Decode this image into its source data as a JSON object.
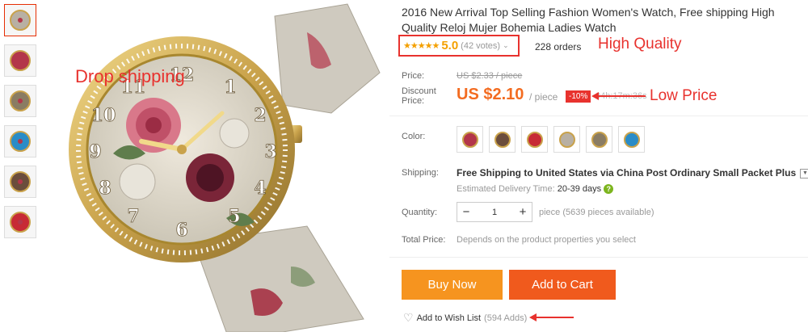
{
  "thumbnails": [
    {
      "name": "thumb-1",
      "band": "#b8b0a3"
    },
    {
      "name": "thumb-2",
      "band": "#b3364a"
    },
    {
      "name": "thumb-3",
      "band": "#8a7c63"
    },
    {
      "name": "thumb-4",
      "band": "#2a8cc7"
    },
    {
      "name": "thumb-5",
      "band": "#6b4d3c"
    },
    {
      "name": "thumb-6",
      "band": "#c72a35"
    }
  ],
  "overlays": {
    "drop_shipping": "Drop shipping",
    "high_quality": "High Quality",
    "low_price": "Low Price"
  },
  "product": {
    "title": "2016 New Arrival Top Selling Fashion Women's Watch, Free shipping High Quality Reloj Mujer Bohemia Ladies Watch",
    "stars": "★★★★★",
    "rating": "5.0",
    "votes": "(42 votes)",
    "orders": "228 orders"
  },
  "price": {
    "price_label": "Price:",
    "original": "US $2.33 / piece",
    "discount_label_1": "Discount",
    "discount_label_2": "Price:",
    "current": "US $2.10",
    "unit": "/ piece",
    "discount_badge": "-10%",
    "timer": "04h:17m:36s"
  },
  "color": {
    "label": "Color:",
    "swatches": [
      "#b3364a",
      "#6b4d3c",
      "#c72a35",
      "#b8b0a3",
      "#8a7c63",
      "#2a8cc7"
    ]
  },
  "shipping": {
    "label": "Shipping:",
    "free_text": "Free Shipping",
    "to_text": " to United States via China Post Ordinary Small Packet Plus",
    "delivery_label": "Estimated Delivery Time:",
    "delivery_value": "20-39 days"
  },
  "quantity": {
    "label": "Quantity:",
    "value": "1",
    "minus": "−",
    "plus": "+",
    "available": "piece (5639 pieces available)"
  },
  "total": {
    "label": "Total Price:",
    "value": "Depends on the product properties you select"
  },
  "actions": {
    "buy_now": "Buy Now",
    "add_to_cart": "Add to Cart",
    "wish_list": "Add to Wish List",
    "wish_count": "(594 Adds)"
  },
  "colors": {
    "accent_red": "#e8322e",
    "price_orange": "#f36c21",
    "buy_orange": "#f6941f",
    "cart_orange": "#f05a1d",
    "gold": "#c9a24b"
  }
}
